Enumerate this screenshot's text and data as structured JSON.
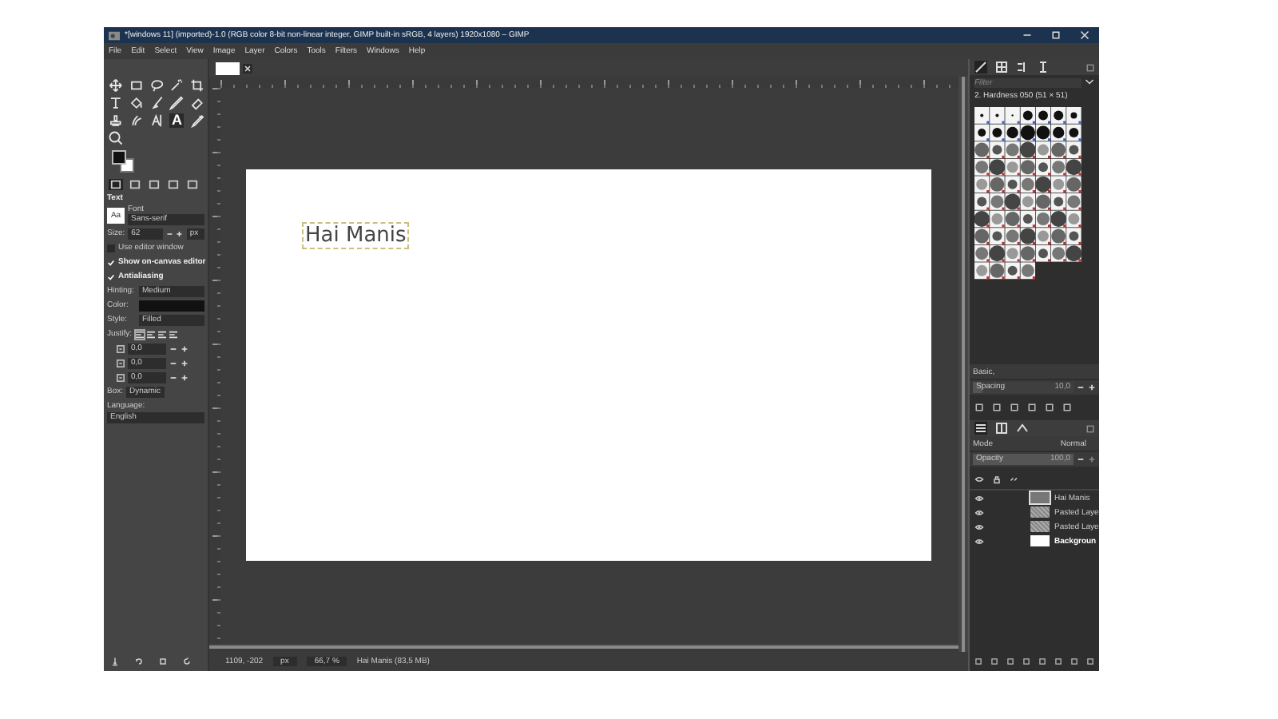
{
  "window": {
    "title": "*[windows 11] (imported)-1.0 (RGB color 8-bit non-linear integer, GIMP built-in sRGB, 4 layers) 1920x1080 – GIMP"
  },
  "menu": [
    "File",
    "Edit",
    "Select",
    "View",
    "Image",
    "Layer",
    "Colors",
    "Tools",
    "Filters",
    "Windows",
    "Help"
  ],
  "toolbox": {
    "text_tool_glyph": "A"
  },
  "tool_options": {
    "title": "Text",
    "font_label": "Font",
    "font_preview": "Aa",
    "font": "Sans-serif",
    "size_label": "Size:",
    "size": "62",
    "unit": "px",
    "options": [
      {
        "label": "Use editor window",
        "checked": false
      },
      {
        "label": "Show on-canvas editor",
        "checked": true
      },
      {
        "label": "Antialiasing",
        "checked": true
      }
    ],
    "hinting_label": "Hinting:",
    "hinting": "Medium",
    "color_label": "Color:",
    "style_label": "Style:",
    "style": "Filled",
    "justify_label": "Justify:",
    "spacings": [
      "0,0",
      "0,0",
      "0,0"
    ],
    "box_label": "Box:",
    "box": "Dynamic",
    "language_label": "Language:",
    "language": "English"
  },
  "canvas": {
    "text": "Hai Manis"
  },
  "brushes": {
    "filter_placeholder": "Filter",
    "brush_name": "2. Hardness 050 (51 × 51)",
    "preset": "Basic,",
    "spacing": {
      "label": "Spacing",
      "value": "10,0",
      "level": 0.1
    }
  },
  "layers": {
    "mode_label": "Mode",
    "mode": "Normal",
    "opacity": {
      "label": "Opacity",
      "value": "100,0",
      "level": 1
    },
    "items": [
      {
        "name": "Hai Manis",
        "kind": "text",
        "selected": true
      },
      {
        "name": "Pasted Laye",
        "kind": "pasted",
        "selected": false
      },
      {
        "name": "Pasted Laye",
        "kind": "pasted",
        "selected": false
      },
      {
        "name": "Backgroun",
        "kind": "background",
        "selected": false
      }
    ]
  },
  "status": {
    "coords": "1109, -202",
    "unit": "px",
    "zoom": "66,7 %",
    "info": "Hai Manis (83,5 MB)"
  }
}
